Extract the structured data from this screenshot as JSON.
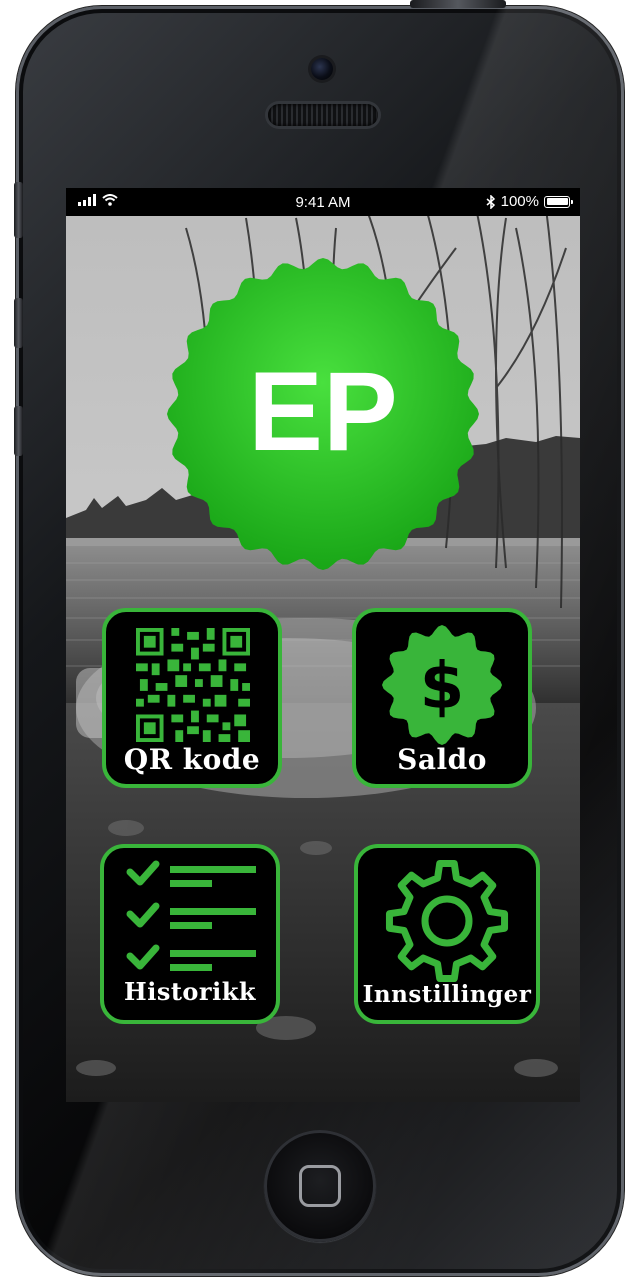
{
  "status_bar": {
    "time": "9:41 AM",
    "battery": "100%",
    "signal_icon": "cellular-signal-icon",
    "wifi_icon": "wifi-icon",
    "bluetooth_icon": "bluetooth-icon"
  },
  "logo": {
    "text": "EP",
    "color": "#2ec52b"
  },
  "tiles": [
    {
      "label": "QR kode",
      "icon": "qr-code-icon"
    },
    {
      "label": "Saldo",
      "icon": "dollar-badge-icon"
    },
    {
      "label": "Historikk",
      "icon": "checklist-icon"
    },
    {
      "label": "Innstillinger",
      "icon": "gear-icon"
    }
  ],
  "colors": {
    "accent": "#39b53a",
    "tile_background": "#000000",
    "label_text": "#ffffff"
  }
}
